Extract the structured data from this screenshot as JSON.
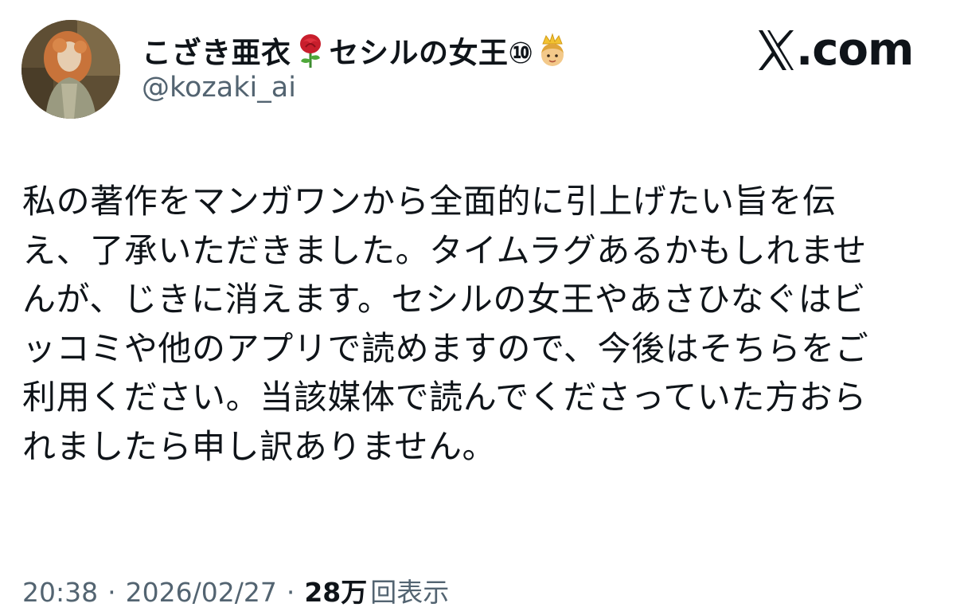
{
  "author": {
    "display_name": "こざき亜衣",
    "display_name_suffix": "セシルの女王⑩",
    "handle": "@kozaki_ai",
    "icons": [
      "avatar-portrait",
      "rose-emoji",
      "princess-emoji"
    ]
  },
  "brand": {
    "text": ".com",
    "icon": "x-logo-icon"
  },
  "tweet": {
    "lines": [
      "私の著作をマンガワンから全面的に引上げたい旨を伝",
      "え、了承いただきました。タイムラグあるかもしれませ",
      "んが、じきに消えます。セシルの女王やあさひなぐはビ",
      "ッコミや他のアプリで読めますので、今後はそちらをご",
      "利用ください。当該媒体で読んでくださっていた方おら",
      "れましたら申し訳ありません。"
    ]
  },
  "meta": {
    "time": "20:38",
    "separator": "·",
    "date": "2026/02/27",
    "views_count": "28万",
    "views_label": "回表示"
  },
  "colors": {
    "text": "#0f1419",
    "secondary": "#536471",
    "background": "#ffffff"
  }
}
